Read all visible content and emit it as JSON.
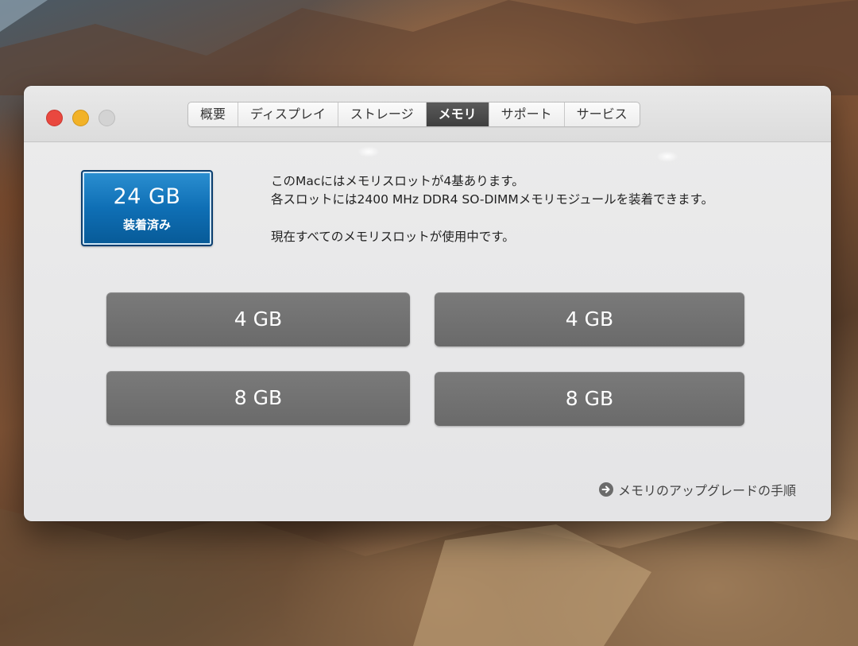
{
  "window": {
    "tabs": [
      {
        "label": "概要",
        "active": false
      },
      {
        "label": "ディスプレイ",
        "active": false
      },
      {
        "label": "ストレージ",
        "active": false
      },
      {
        "label": "メモリ",
        "active": true
      },
      {
        "label": "サポート",
        "active": false
      },
      {
        "label": "サービス",
        "active": false
      }
    ]
  },
  "memory": {
    "total": "24 GB",
    "total_label": "装着済み",
    "info_line_1": "このMacにはメモリスロットが4基あります。",
    "info_line_2": "各スロットには2400 MHz DDR4 SO-DIMMメモリモジュールを装着できます。",
    "info_line_3": "現在すべてのメモリスロットが使用中です。",
    "slots": [
      "4 GB",
      "4 GB",
      "8 GB",
      "8 GB"
    ],
    "upgrade_link": "メモリのアップグレードの手順"
  },
  "colors": {
    "badge_blue": "#0f6fb5",
    "slot_gray": "#6e6e6e",
    "close_red": "#e9483f",
    "minimize_yellow": "#f2b227"
  }
}
